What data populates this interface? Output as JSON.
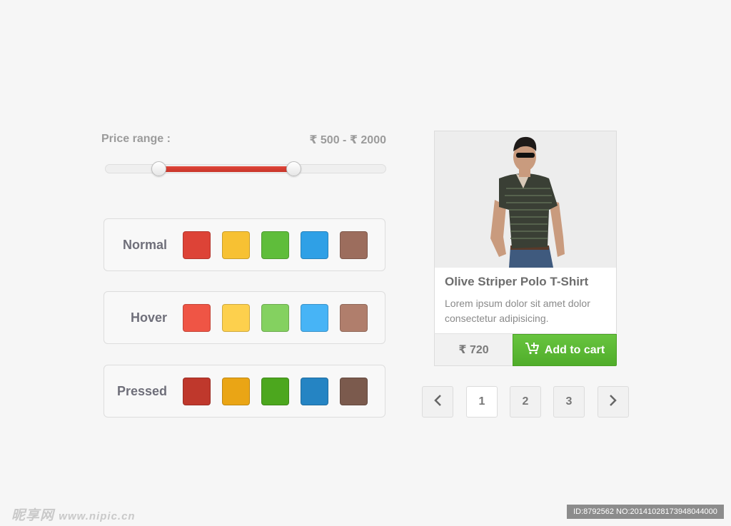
{
  "price_range": {
    "label": "Price range :",
    "value_text": "₹ 500 - ₹ 2000",
    "fill_start_fraction": 0.19,
    "fill_end_fraction": 0.67
  },
  "swatch_rows": [
    {
      "label": "Normal",
      "colors": [
        "#dd4337",
        "#f7c133",
        "#5fbd3b",
        "#2fa0e6",
        "#9c6d5d"
      ]
    },
    {
      "label": "Hover",
      "colors": [
        "#ef5545",
        "#fdd04d",
        "#84d160",
        "#47b4f6",
        "#b07e6c"
      ]
    },
    {
      "label": "Pressed",
      "colors": [
        "#bf382c",
        "#eaa515",
        "#4ca71e",
        "#2584c3",
        "#7b5a4d"
      ]
    }
  ],
  "product": {
    "title": "Olive Striper Polo T-Shirt",
    "description": "Lorem ipsum dolor sit amet dolor consectetur adipisicing.",
    "price": "₹ 720",
    "add_to_cart_label": "Add to cart",
    "cart_icon": "cart-plus-icon"
  },
  "pagination": {
    "prev_icon": "chevron-left-icon",
    "pages": [
      "1",
      "2",
      "3"
    ],
    "active_page": "1",
    "next_icon": "chevron-right-icon"
  },
  "watermark": {
    "site_text": "昵享网",
    "url": "www.nipic.cn",
    "id_text": "ID:8792562 NO:20141028173948044000"
  },
  "colors": {
    "background": "#f6f6f6",
    "slider_fill": "#d63b30",
    "cart_green": "#5cb934"
  }
}
